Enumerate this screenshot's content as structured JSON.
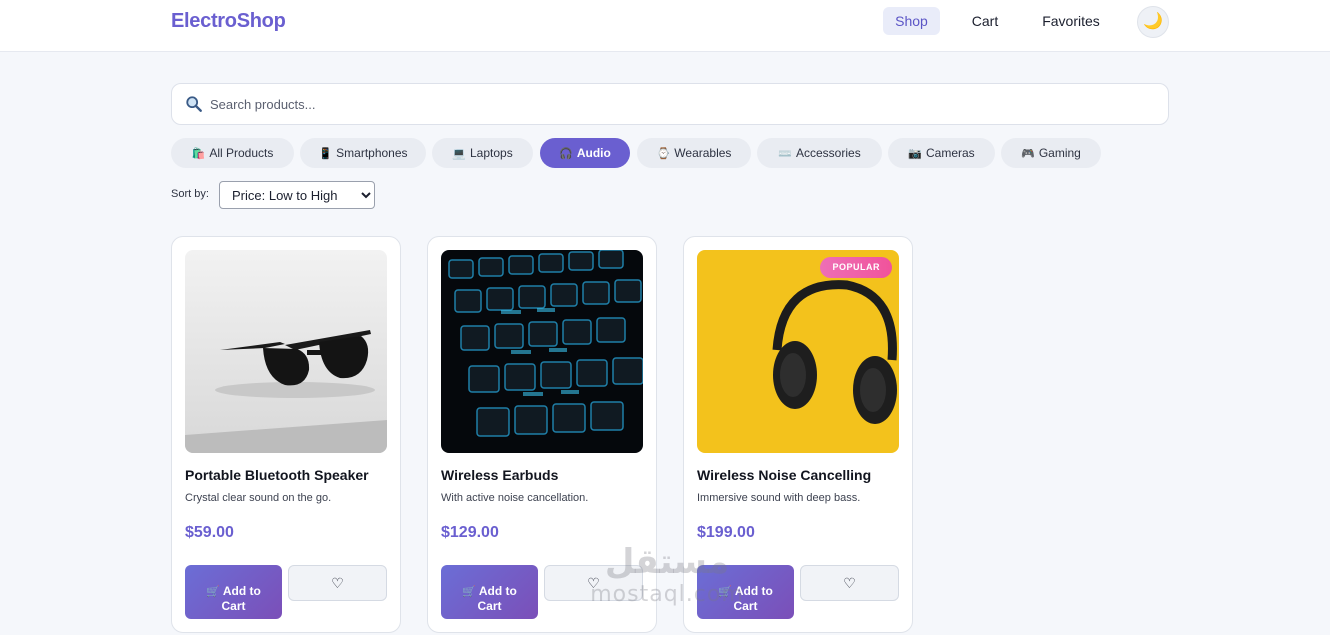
{
  "header": {
    "logo": "ElectroShop",
    "nav": [
      {
        "label": "Shop",
        "active": true
      },
      {
        "label": "Cart"
      },
      {
        "label": "Favorites"
      }
    ],
    "theme_toggle_icon": "moon-icon"
  },
  "search": {
    "placeholder": "Search products...",
    "value": "",
    "icon": "search-icon"
  },
  "categories": [
    {
      "icon": "🛍️",
      "label": "All Products"
    },
    {
      "icon": "📱",
      "label": "Smartphones"
    },
    {
      "icon": "💻",
      "label": "Laptops"
    },
    {
      "icon": "🎧",
      "label": "Audio",
      "active": true
    },
    {
      "icon": "⌚",
      "label": "Wearables"
    },
    {
      "icon": "⌨️",
      "label": "Accessories"
    },
    {
      "icon": "📷",
      "label": "Cameras"
    },
    {
      "icon": "🎮",
      "label": "Gaming"
    }
  ],
  "sort": {
    "label": "Sort by:",
    "selected": "Price: Low to High"
  },
  "products": [
    {
      "title": "Portable Bluetooth Speaker",
      "description": "Crystal clear sound on the go.",
      "price": "$59.00",
      "add_label_1": "Add to",
      "add_label_2": "Cart",
      "image": "sunglasses-photo"
    },
    {
      "title": "Wireless Earbuds",
      "description": "With active noise cancellation.",
      "price": "$129.00",
      "add_label_1": "Add to",
      "add_label_2": "Cart",
      "image": "keyboard-photo"
    },
    {
      "title": "Wireless Noise Cancelling",
      "description": "Immersive sound with deep bass.",
      "price": "$199.00",
      "add_label_1": "Add to",
      "add_label_2": "Cart",
      "badge": "POPULAR",
      "image": "headphones-photo"
    }
  ],
  "watermark": {
    "line1": "مستقل",
    "line2": "mostaql.com"
  },
  "colors": {
    "accent": "#6a5fd0",
    "badge": "#f0539b",
    "background": "#f5f7fb"
  }
}
